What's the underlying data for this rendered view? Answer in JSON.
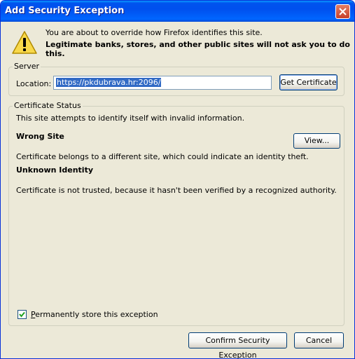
{
  "window": {
    "title": "Add Security Exception"
  },
  "intro": {
    "line1": "You are about to override how Firefox identifies this site.",
    "line2": "Legitimate banks, stores, and other public sites will not ask you to do this."
  },
  "server": {
    "legend": "Server",
    "location_label": "Location:",
    "location_value": "https://pkdubrava.hr:2096/",
    "get_certificate_label": "Get Certificate"
  },
  "status": {
    "legend": "Certificate Status",
    "summary": "This site attempts to identify itself with invalid information.",
    "view_label": "View...",
    "wrong_site_title": "Wrong Site",
    "wrong_site_text": "Certificate belongs to a different site, which could indicate an identity theft.",
    "unknown_identity_title": "Unknown Identity",
    "unknown_identity_text": "Certificate is not trusted, because it hasn't been verified by a recognized authority."
  },
  "permanent": {
    "label_underlined": "P",
    "label_rest": "ermanently store this exception",
    "checked": true
  },
  "footer": {
    "confirm_label": "Confirm Security Exception",
    "cancel_label": "Cancel"
  },
  "icons": {
    "close": "close-icon",
    "warning": "warning-icon",
    "check": "checkmark-icon"
  },
  "colors": {
    "title_bar": "#0053ee",
    "window_bg": "#ece9d8",
    "close_button": "#c7402a",
    "selection": "#316ac5"
  }
}
